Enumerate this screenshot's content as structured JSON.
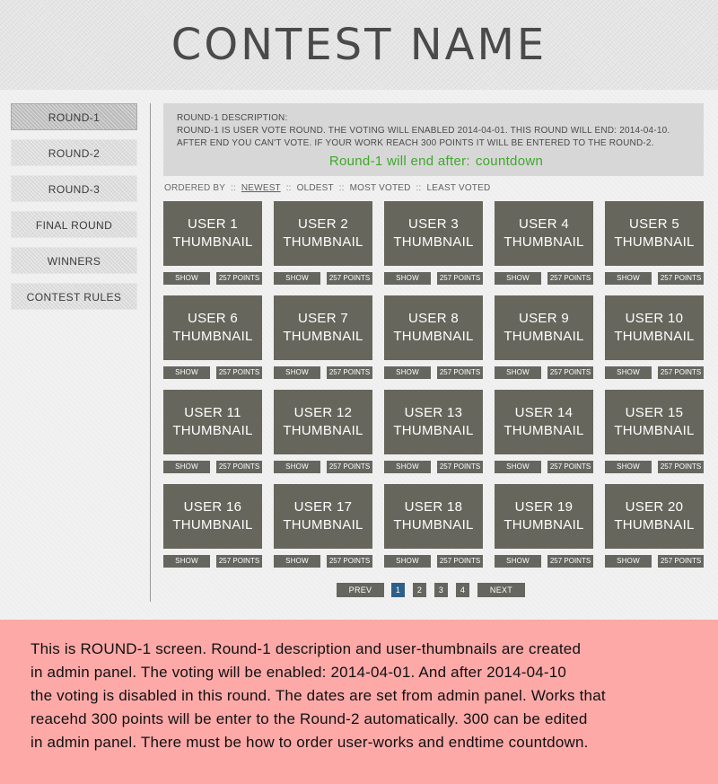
{
  "header": {
    "title": "CONTEST  NAME"
  },
  "sidebar": {
    "items": [
      {
        "label": "ROUND-1",
        "active": true
      },
      {
        "label": "ROUND-2",
        "active": false
      },
      {
        "label": "ROUND-3",
        "active": false
      },
      {
        "label": "FINAL ROUND",
        "active": false
      },
      {
        "label": "WINNERS",
        "active": false
      },
      {
        "label": "CONTEST RULES",
        "active": false
      }
    ]
  },
  "description": {
    "heading": "ROUND-1 DESCRIPTION:",
    "line1": "ROUND-1 IS USER VOTE ROUND. THE VOTING WILL ENABLED 2014-04-01.  THIS ROUND WILL END: 2014-04-10.",
    "line2": "AFTER END YOU CAN'T VOTE. IF YOUR WORK REACH 300 POINTS IT WILL BE ENTERED TO THE ROUND-2.",
    "countdown_label": "Round-1 will end after:",
    "countdown_value": "countdown"
  },
  "ordering": {
    "label": "ORDERED BY",
    "separator": "::",
    "options": [
      "NEWEST",
      "OLDEST",
      "MOST VOTED",
      "LEAST VOTED"
    ],
    "current": "NEWEST"
  },
  "cards": [
    {
      "user": "USER 1",
      "thumb": "THUMBNAIL",
      "show": "SHOW",
      "points": "257 POINTS"
    },
    {
      "user": "USER 2",
      "thumb": "THUMBNAIL",
      "show": "SHOW",
      "points": "257 POINTS"
    },
    {
      "user": "USER 3",
      "thumb": "THUMBNAIL",
      "show": "SHOW",
      "points": "257 POINTS"
    },
    {
      "user": "USER 4",
      "thumb": "THUMBNAIL",
      "show": "SHOW",
      "points": "257 POINTS"
    },
    {
      "user": "USER 5",
      "thumb": "THUMBNAIL",
      "show": "SHOW",
      "points": "257 POINTS"
    },
    {
      "user": "USER 6",
      "thumb": "THUMBNAIL",
      "show": "SHOW",
      "points": "257 POINTS"
    },
    {
      "user": "USER 7",
      "thumb": "THUMBNAIL",
      "show": "SHOW",
      "points": "257 POINTS"
    },
    {
      "user": "USER 8",
      "thumb": "THUMBNAIL",
      "show": "SHOW",
      "points": "257 POINTS"
    },
    {
      "user": "USER 9",
      "thumb": "THUMBNAIL",
      "show": "SHOW",
      "points": "257 POINTS"
    },
    {
      "user": "USER 10",
      "thumb": "THUMBNAIL",
      "show": "SHOW",
      "points": "257 POINTS"
    },
    {
      "user": "USER 11",
      "thumb": "THUMBNAIL",
      "show": "SHOW",
      "points": "257 POINTS"
    },
    {
      "user": "USER 12",
      "thumb": "THUMBNAIL",
      "show": "SHOW",
      "points": "257 POINTS"
    },
    {
      "user": "USER 13",
      "thumb": "THUMBNAIL",
      "show": "SHOW",
      "points": "257 POINTS"
    },
    {
      "user": "USER 14",
      "thumb": "THUMBNAIL",
      "show": "SHOW",
      "points": "257 POINTS"
    },
    {
      "user": "USER 15",
      "thumb": "THUMBNAIL",
      "show": "SHOW",
      "points": "257 POINTS"
    },
    {
      "user": "USER 16",
      "thumb": "THUMBNAIL",
      "show": "SHOW",
      "points": "257 POINTS"
    },
    {
      "user": "USER 17",
      "thumb": "THUMBNAIL",
      "show": "SHOW",
      "points": "257 POINTS"
    },
    {
      "user": "USER 18",
      "thumb": "THUMBNAIL",
      "show": "SHOW",
      "points": "257 POINTS"
    },
    {
      "user": "USER 19",
      "thumb": "THUMBNAIL",
      "show": "SHOW",
      "points": "257 POINTS"
    },
    {
      "user": "USER 20",
      "thumb": "THUMBNAIL",
      "show": "SHOW",
      "points": "257 POINTS"
    }
  ],
  "pagination": {
    "prev": "PREV",
    "pages": [
      "1",
      "2",
      "3",
      "4"
    ],
    "current": "1",
    "next": "NEXT"
  },
  "note": {
    "lines": [
      "This is ROUND-1 screen. Round-1 description and user-thumbnails are created",
      "in admin panel. The voting will be enabled: 2014-04-01. And after 2014-04-10",
      "the voting is disabled in this round. The dates are set from admin panel. Works that",
      "reacehd 300 points will be enter to the Round-2 automatically. 300 can be edited",
      "in admin panel. There must be how to order user-works and endtime countdown."
    ]
  },
  "colors": {
    "thumbnail": "#66665c",
    "countdown": "#3fa82c",
    "active_page": "#2e5f8a",
    "note_background": "#fca9a8"
  }
}
